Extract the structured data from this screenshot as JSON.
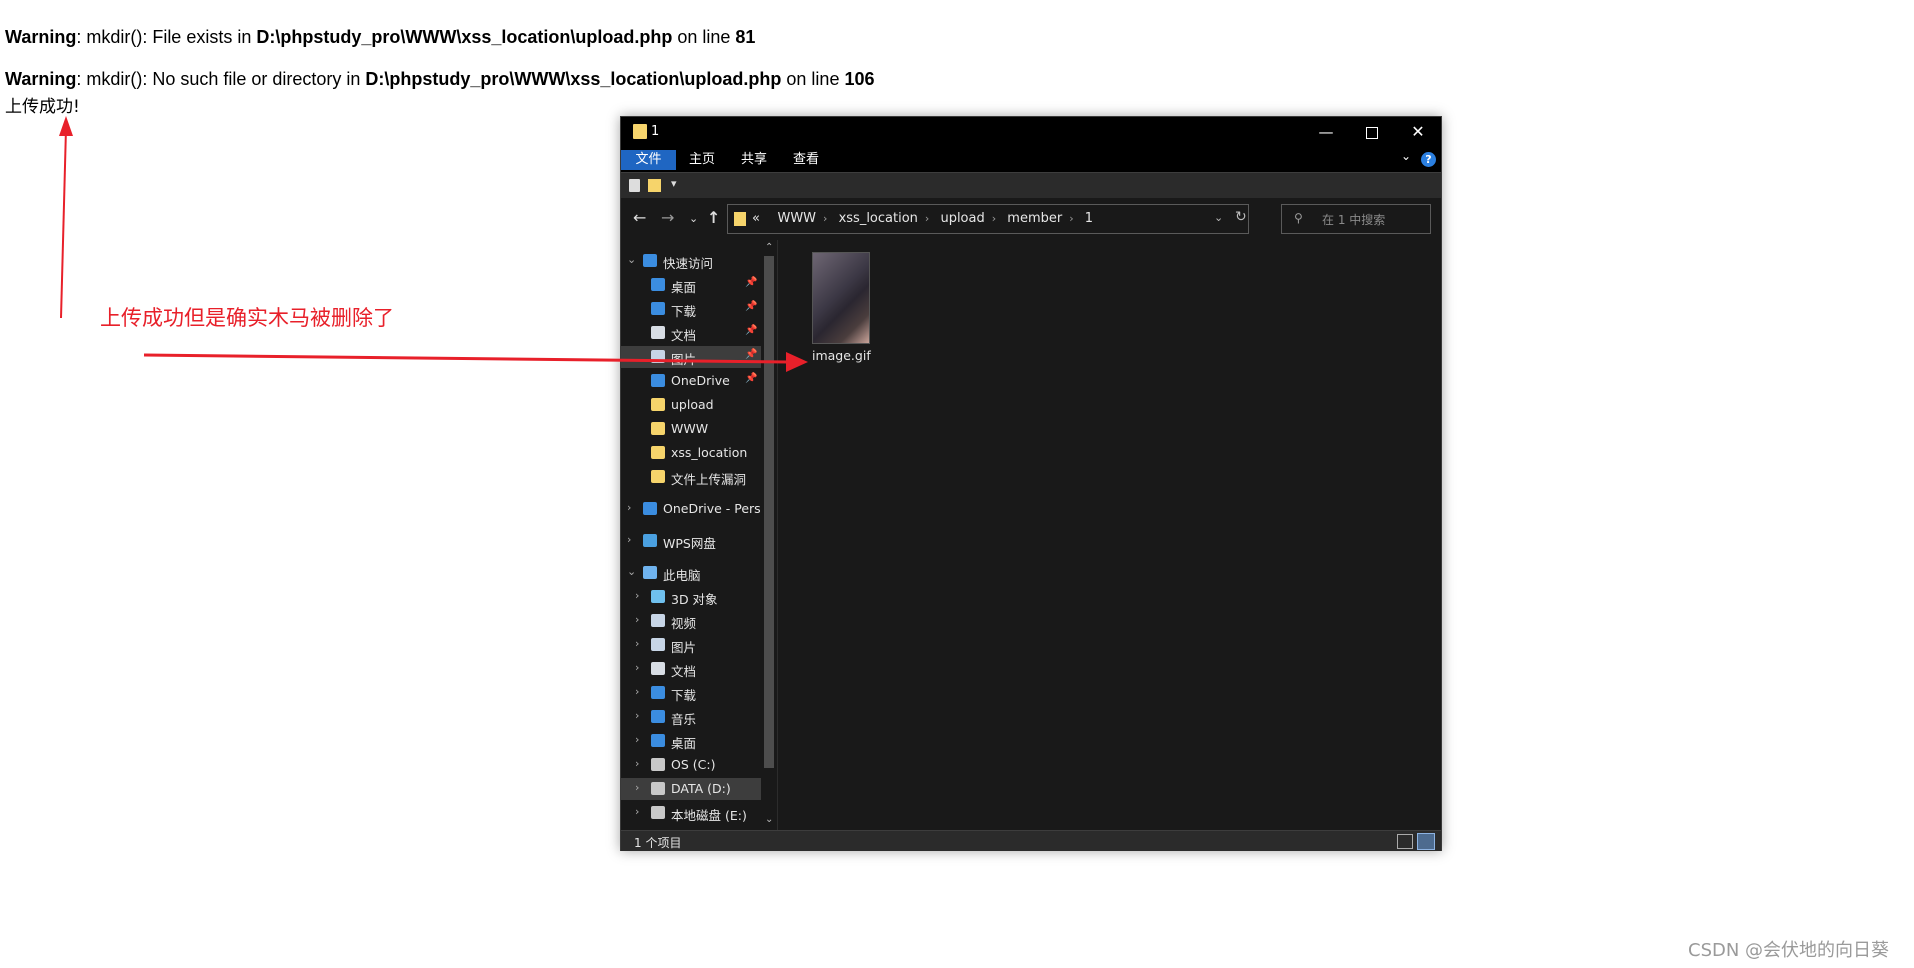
{
  "php_output": {
    "warning1": {
      "label": "Warning",
      "text1": ": mkdir(): File exists in ",
      "path": "D:\\phpstudy_pro\\WWW\\xss_location\\upload.php",
      "text2": " on line ",
      "line": "81"
    },
    "warning2": {
      "label": "Warning",
      "text1": ": mkdir(): No such file or directory in ",
      "path": "D:\\phpstudy_pro\\WWW\\xss_location\\upload.php",
      "text2": " on line ",
      "line": "106"
    },
    "success": "上传成功!"
  },
  "annotation": {
    "text": "上传成功但是确实木马被删除了",
    "color": "#e8202a"
  },
  "explorer": {
    "title": "1",
    "ribbon_tabs": [
      "文件",
      "主页",
      "共享",
      "查看"
    ],
    "breadcrumb": [
      "«",
      "WWW",
      "xss_location",
      "upload",
      "member",
      "1"
    ],
    "search_placeholder": "在 1 中搜索",
    "sidebar": [
      {
        "label": "快速访问",
        "icon": "star-icon",
        "expand": "v"
      },
      {
        "label": "桌面",
        "icon": "desktop-icon",
        "pinned": true
      },
      {
        "label": "下载",
        "icon": "download-icon",
        "pinned": true
      },
      {
        "label": "文档",
        "icon": "document-icon",
        "pinned": true
      },
      {
        "label": "图片",
        "icon": "picture-icon",
        "pinned": true
      },
      {
        "label": "OneDrive",
        "icon": "onedrive-icon",
        "pinned": true
      },
      {
        "label": "upload",
        "icon": "folder-icon"
      },
      {
        "label": "WWW",
        "icon": "folder-icon"
      },
      {
        "label": "xss_location",
        "icon": "folder-icon"
      },
      {
        "label": "文件上传漏洞",
        "icon": "folder-icon"
      },
      {
        "label": "OneDrive - Perso",
        "icon": "onedrive-icon",
        "expand": ">"
      },
      {
        "label": "WPS网盘",
        "icon": "cloud-icon",
        "expand": ">"
      },
      {
        "label": "此电脑",
        "icon": "computer-icon",
        "expand": "v"
      },
      {
        "label": "3D 对象",
        "icon": "cube-icon",
        "expand": ">"
      },
      {
        "label": "视频",
        "icon": "video-icon",
        "expand": ">"
      },
      {
        "label": "图片",
        "icon": "picture-icon",
        "expand": ">"
      },
      {
        "label": "文档",
        "icon": "document-icon",
        "expand": ">"
      },
      {
        "label": "下载",
        "icon": "download-icon",
        "expand": ">"
      },
      {
        "label": "音乐",
        "icon": "music-icon",
        "expand": ">"
      },
      {
        "label": "桌面",
        "icon": "desktop-icon",
        "expand": ">"
      },
      {
        "label": "OS (C:)",
        "icon": "drive-icon",
        "expand": ">"
      },
      {
        "label": "DATA (D:)",
        "icon": "drive-icon",
        "expand": ">"
      },
      {
        "label": "本地磁盘 (E:)",
        "icon": "drive-icon",
        "expand": ">"
      }
    ],
    "file": {
      "name": "image.gif"
    },
    "status": "1 个项目"
  },
  "colors": {
    "folder": "#f6d46b",
    "accent": "#1f66c2"
  },
  "watermark": "CSDN @会伏地的向日葵"
}
